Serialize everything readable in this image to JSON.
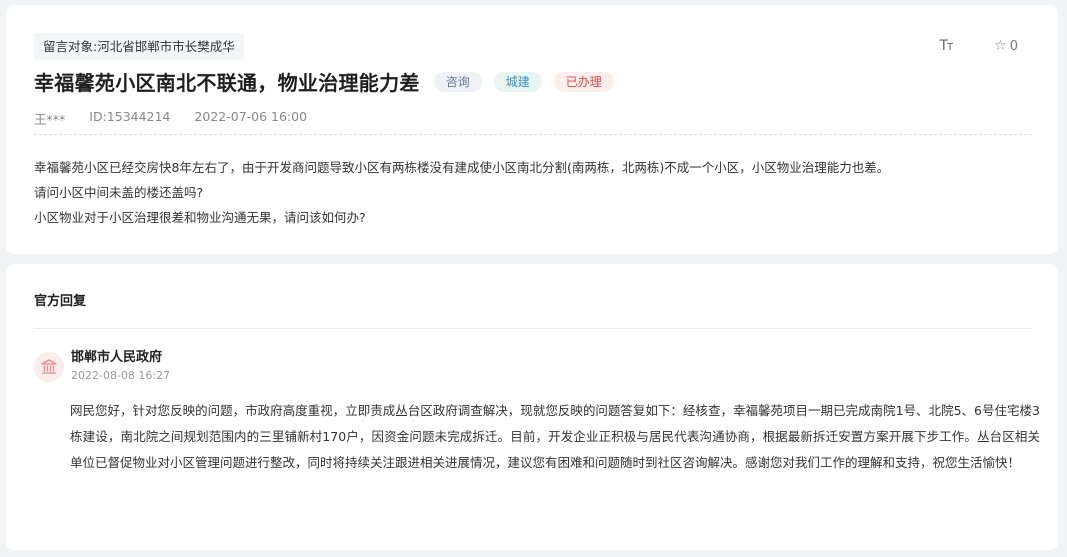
{
  "message": {
    "target_label": "留言对象:",
    "target_value": "河北省邯郸市市长樊成华",
    "title": "幸福馨苑小区南北不联通，物业治理能力差",
    "tags": {
      "type": "咨询",
      "department": "城建",
      "status": "已办理"
    },
    "author": "王***",
    "id_text": "ID:15344214",
    "datetime": "2022-07-06 16:00",
    "content_lines": [
      "幸福馨苑小区已经交房快8年左右了，由于开发商问题导致小区有两栋楼没有建成使小区南北分割(南两栋，北两栋)不成一个小区，小区物业治理能力也差。",
      "请问小区中间未盖的楼还盖吗?",
      "小区物业对于小区治理很差和物业沟通无果，请问该如何办?"
    ]
  },
  "tools": {
    "font_size_icon": "font-size-icon",
    "star_icon": "star-icon",
    "star_count": "0"
  },
  "reply": {
    "heading": "官方回复",
    "org_icon": "government-building-icon",
    "org_name": "邯郸市人民政府",
    "org_date": "2022-08-08 16:27",
    "content": "网民您好，针对您反映的问题，市政府高度重视，立即责成丛台区政府调查解决，现就您反映的问题答复如下：经核查，幸福馨苑项目一期已完成南院1号、北院5、6号住宅楼3栋建设，南北院之间规划范围内的三里铺新村170户，因资金问题未完成拆迁。目前，开发企业正积极与居民代表沟通协商，根据最新拆迁安置方案开展下步工作。丛台区相关单位已督促物业对小区管理问题进行整改，同时将持续关注跟进相关进展情况，建议您有困难和问题随时到社区咨询解决。感谢您对我们工作的理解和支持，祝您生活愉快！"
  },
  "colors": {
    "page_bg": "#f2f3f5",
    "tag_status": "#e0474a",
    "tag_department": "#3d8fba",
    "tag_type": "#6a7a94",
    "org_icon": "#e58a8a"
  }
}
